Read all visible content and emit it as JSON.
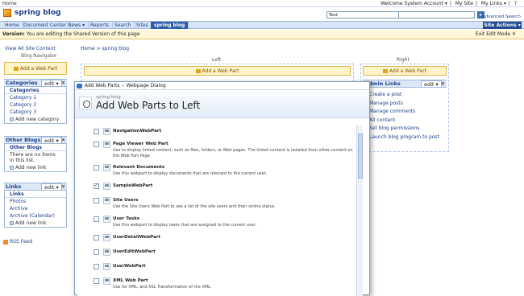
{
  "topbar": {
    "home": "Home",
    "welcome": "Welcome System Account ▾",
    "my_site": "My Site",
    "my_links": "My Links ▾",
    "help": "?"
  },
  "header": {
    "site_title": "spring blog",
    "search_value": "Test",
    "search_button": "▸",
    "advanced_search": "Advanced Search"
  },
  "nav": {
    "tabs": [
      "Home",
      "Document Center",
      "News ▾",
      "Reports",
      "Search",
      "Sites",
      "spring blog"
    ],
    "site_actions": "Site Actions ▾"
  },
  "version_bar": {
    "label": "Version:",
    "text": "You are editing the Shared Version of this page",
    "exit": "Exit Edit Mode ✕"
  },
  "left": {
    "view_all": "View All Site Content",
    "blog_navigator": "Blog Navigator",
    "add_web_part": "Add a Web Part",
    "categories": {
      "title": "Categories",
      "edit": "edit ▾",
      "close": "✕",
      "subhead": "Categories",
      "items": [
        "Category 1",
        "Category 2",
        "Category 3"
      ],
      "add": "Add new category"
    },
    "other_blogs": {
      "title": "Other Blogs",
      "edit": "edit ▾",
      "close": "✕",
      "subhead": "Other Blogs",
      "empty": "There are no items in this list.",
      "add": "Add new link"
    },
    "links": {
      "title": "Links",
      "edit": "edit ▾",
      "close": "✕",
      "subhead": "Links",
      "items": [
        "Photos",
        "Archive",
        "Archive (Calendar)"
      ],
      "add": "Add new link"
    },
    "rss": "RSS Feed"
  },
  "main": {
    "breadcrumb": "Home > spring blog",
    "zone_left": "Left",
    "zone_right": "Right",
    "add_web_part": "Add a Web Part",
    "right_wp": {
      "title": "Admin Links",
      "edit": "edit ▾",
      "close": "✕",
      "items": [
        "Create a post",
        "Manage posts",
        "Manage comments",
        "All content",
        "Set blog permissions",
        "Launch blog program to post"
      ]
    }
  },
  "dialog": {
    "titlebar": "Add Web Parts -- Webpage Dialog",
    "subtitle": "spring blog",
    "title": "Add Web Parts to Left",
    "items": [
      {
        "name": "NavigationWebPart",
        "desc": "",
        "checked": false
      },
      {
        "name": "Page Viewer Web Part",
        "desc": "Use to display linked content, such as files, folders, or Web pages. The linked content is isolated from other content on the Web Part Page.",
        "checked": false
      },
      {
        "name": "Relevant Documents",
        "desc": "Use this webpart to display documents that are relevant to the current user.",
        "checked": false
      },
      {
        "name": "SampleWebPart",
        "desc": "",
        "checked": true
      },
      {
        "name": "Site Users",
        "desc": "Use the Site Users Web Part to see a list of the site users and their online status.",
        "checked": false
      },
      {
        "name": "User Tasks",
        "desc": "Use this webpart to display tasks that are assigned to the current user.",
        "checked": false
      },
      {
        "name": "UserDetailWebPart",
        "desc": "",
        "checked": false
      },
      {
        "name": "UserEditWebPart",
        "desc": "",
        "checked": false
      },
      {
        "name": "UserWebPart",
        "desc": "",
        "checked": false
      },
      {
        "name": "XML Web Part",
        "desc": "Use for XML, and XSL Transformation of the XML.",
        "checked": false
      }
    ]
  }
}
